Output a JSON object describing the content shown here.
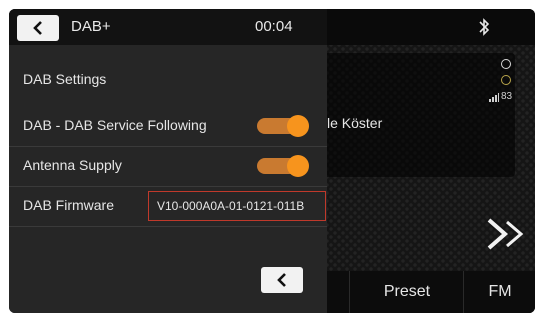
{
  "header": {
    "title": "DAB+",
    "time": "00:04"
  },
  "settings": {
    "section_title": "DAB Settings",
    "rows": [
      {
        "label": "DAB - DAB Service Following",
        "toggle_on": true
      },
      {
        "label": "Antenna Supply",
        "toggle_on": true
      },
      {
        "label": "DAB Firmware",
        "value": "V10-000A0A-01-0121-011B"
      }
    ]
  },
  "background": {
    "artist_fragment": "le Köster",
    "signal_level": "83",
    "buttons": {
      "preset": "Preset",
      "fm": "FM"
    }
  },
  "icons": {
    "back": "chevron-left-icon",
    "bluetooth": "bluetooth-icon",
    "next": "next-icon",
    "signal": "signal-strength-icon"
  },
  "colors": {
    "accent": "#f7941d",
    "highlight_box": "#c0392b"
  }
}
